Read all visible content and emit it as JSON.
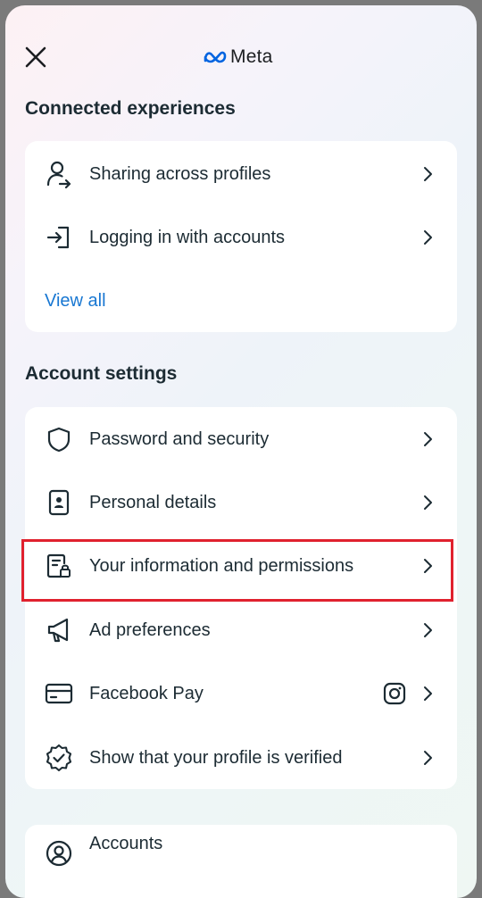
{
  "header": {
    "brand_name": "Meta",
    "close_icon": "close-icon",
    "brand_color": "#0064e0"
  },
  "connected": {
    "title": "Connected experiences",
    "items": [
      {
        "label": "Sharing across profiles",
        "icon": "person-share-icon"
      },
      {
        "label": "Logging in with accounts",
        "icon": "login-arrow-icon"
      }
    ],
    "view_all": "View all"
  },
  "account": {
    "title": "Account settings",
    "items": [
      {
        "label": "Password and security",
        "icon": "shield-icon"
      },
      {
        "label": "Personal details",
        "icon": "id-card-icon"
      },
      {
        "label": "Your information and permissions",
        "icon": "document-lock-icon",
        "highlighted": true
      },
      {
        "label": "Ad preferences",
        "icon": "megaphone-icon"
      },
      {
        "label": "Facebook Pay",
        "icon": "credit-card-icon",
        "badge_icon": "instagram-icon"
      },
      {
        "label": "Show that your profile is verified",
        "icon": "verified-badge-icon"
      }
    ]
  },
  "accounts_card": {
    "label": "Accounts",
    "icon": "user-circle-icon"
  },
  "colors": {
    "link": "#1877d2",
    "highlight_border": "#e0212e",
    "text": "#1c2b33"
  }
}
